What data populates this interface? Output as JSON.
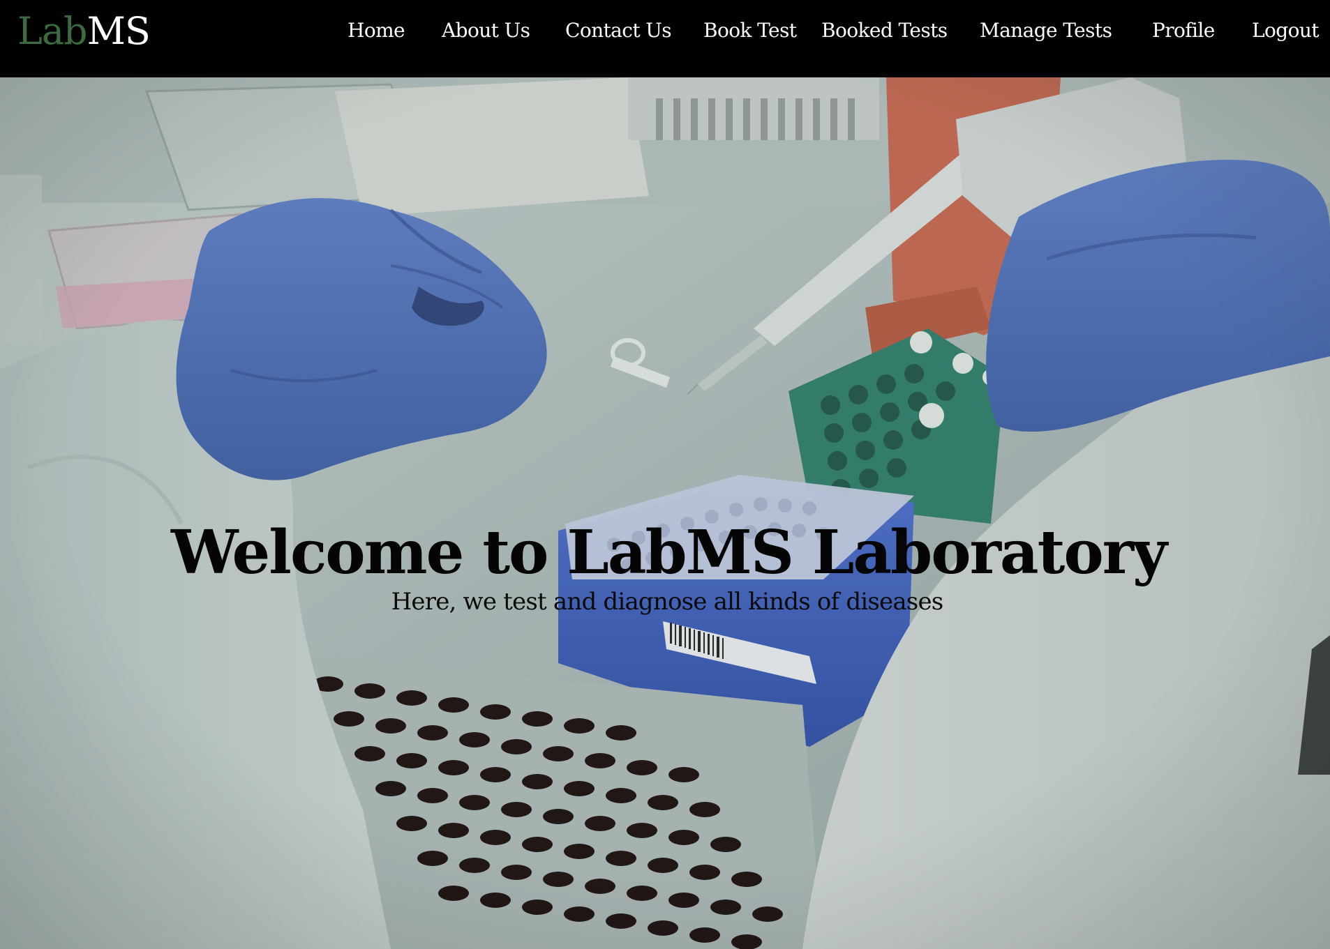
{
  "brand": {
    "part1": "Lab",
    "part2": "MS",
    "part1_color": "#3d6b40",
    "part2_color": "#ffffff"
  },
  "nav": {
    "home": "Home",
    "about": "About Us",
    "contact": "Contact Us",
    "book_test": "Book Test",
    "booked_tests": "Booked Tests",
    "manage_tests": "Manage Tests",
    "profile": "Profile",
    "logout": "Logout"
  },
  "hero": {
    "title": "Welcome to LabMS Laboratory",
    "subtitle": "Here, we test and diagnose all kinds of diseases",
    "image_subject": "lab-technician-gloved-hands-pipette-sample-tubes"
  },
  "colors": {
    "navbar_bg": "#000000",
    "nav_text": "#ffffff",
    "hero_text": "#050505"
  }
}
